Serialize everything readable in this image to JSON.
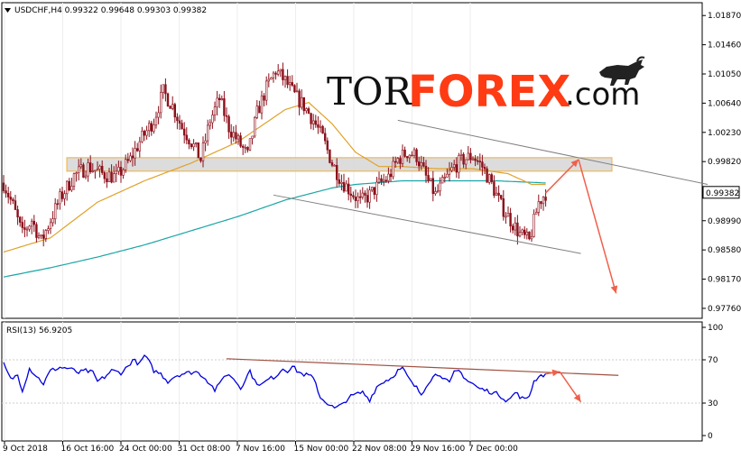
{
  "header": {
    "symbol_line": "USDCHF,H4  0.99322  0.99648  0.99303  0.99382"
  },
  "brand": {
    "tor": "TOR",
    "forex": "FOREX",
    "com": ".com",
    "logo_icon": "bull-icon"
  },
  "rsi_panel": {
    "label": "RSI(13) 56.9205"
  },
  "colors": {
    "candle": "#8b0f1a",
    "ma_slow": "#1aa6a6",
    "ma_fast": "#e0a22a",
    "channel": "#808080",
    "forecast_arrow": "#f0604a",
    "zone_fill": "#d6d6d6",
    "zone_border": "#f0b040",
    "rsi_line": "#0000e0",
    "rsi_trend": "#a05040",
    "brand_accent": "#ff3b14"
  },
  "chart_data": [
    {
      "type": "candlestick",
      "symbol": "USDCHF",
      "timeframe": "H4",
      "ylim": [
        0.9762,
        1.0205
      ],
      "x_ticks": [
        "9 Oct 2018",
        "16 Oct 16:00",
        "24 Oct 00:00",
        "31 Oct 08:00",
        "7 Nov 16:00",
        "15 Nov 00:00",
        "22 Nov 08:00",
        "29 Nov 16:00",
        "7 Dec 00:00"
      ],
      "y_ticks": [
        "1.01870",
        "1.01460",
        "1.01050",
        "1.00640",
        "1.00230",
        "0.99820",
        "0.99382",
        "0.98990",
        "0.98580",
        "0.98170",
        "0.97760"
      ],
      "y_tick_values": [
        1.0187,
        1.0146,
        1.0105,
        1.0064,
        1.0023,
        0.9982,
        0.99382,
        0.9899,
        0.9858,
        0.9817,
        0.9776
      ],
      "current_price": "0.99382",
      "current_price_value": 0.99382,
      "close_anchors": [
        [
          0,
          0.9952
        ],
        [
          4,
          0.992
        ],
        [
          8,
          0.988
        ],
        [
          12,
          0.99
        ],
        [
          16,
          0.987
        ],
        [
          20,
          0.99
        ],
        [
          24,
          0.993
        ],
        [
          30,
          0.9962
        ],
        [
          36,
          0.9975
        ],
        [
          42,
          0.9965
        ],
        [
          48,
          0.996
        ],
        [
          54,
          0.9985
        ],
        [
          58,
          1.001
        ],
        [
          64,
          1.004
        ],
        [
          68,
          1.008
        ],
        [
          72,
          1.006
        ],
        [
          76,
          1.003
        ],
        [
          80,
          1.001
        ],
        [
          84,
          0.9985
        ],
        [
          88,
          1.004
        ],
        [
          92,
          1.007
        ],
        [
          96,
          1.003
        ],
        [
          100,
          1.001
        ],
        [
          104,
          0.999
        ],
        [
          108,
          1.005
        ],
        [
          112,
          1.0085
        ],
        [
          116,
          1.011
        ],
        [
          120,
          1.0095
        ],
        [
          124,
          1.0075
        ],
        [
          128,
          1.006
        ],
        [
          132,
          1.004
        ],
        [
          136,
          1.0015
        ],
        [
          140,
          0.998
        ],
        [
          144,
          0.9955
        ],
        [
          148,
          0.994
        ],
        [
          152,
          0.9925
        ],
        [
          156,
          0.9935
        ],
        [
          160,
          0.995
        ],
        [
          164,
          0.996
        ],
        [
          168,
          0.9985
        ],
        [
          172,
          0.9995
        ],
        [
          176,
          0.999
        ],
        [
          180,
          0.996
        ],
        [
          184,
          0.9935
        ],
        [
          188,
          0.9955
        ],
        [
          192,
          0.9975
        ],
        [
          196,
          0.9985
        ],
        [
          200,
          0.999
        ],
        [
          204,
          0.9975
        ],
        [
          208,
          0.995
        ],
        [
          212,
          0.992
        ],
        [
          216,
          0.99
        ],
        [
          220,
          0.988
        ],
        [
          224,
          0.987
        ],
        [
          228,
          0.9925
        ],
        [
          231,
          0.9938
        ]
      ],
      "ma_fast_anchors": [
        [
          0,
          0.9855
        ],
        [
          20,
          0.9875
        ],
        [
          40,
          0.9925
        ],
        [
          60,
          0.9955
        ],
        [
          80,
          0.998
        ],
        [
          100,
          1.001
        ],
        [
          120,
          1.0055
        ],
        [
          130,
          1.0065
        ],
        [
          140,
          1.0035
        ],
        [
          150,
          0.9995
        ],
        [
          160,
          0.9975
        ],
        [
          170,
          0.9975
        ],
        [
          185,
          0.9972
        ],
        [
          200,
          0.9972
        ],
        [
          215,
          0.9965
        ],
        [
          225,
          0.995
        ],
        [
          231,
          0.995
        ]
      ],
      "ma_slow_anchors": [
        [
          0,
          0.982
        ],
        [
          20,
          0.9833
        ],
        [
          40,
          0.9848
        ],
        [
          60,
          0.9865
        ],
        [
          80,
          0.9885
        ],
        [
          100,
          0.9905
        ],
        [
          120,
          0.9928
        ],
        [
          140,
          0.9945
        ],
        [
          150,
          0.995
        ],
        [
          170,
          0.9955
        ],
        [
          190,
          0.9955
        ],
        [
          210,
          0.9955
        ],
        [
          231,
          0.9952
        ]
      ],
      "resistance_zone": [
        0.99685,
        0.99875
      ],
      "channel_upper": [
        [
          168,
          1.004
        ],
        [
          300,
          0.995
        ]
      ],
      "channel_lower": [
        [
          115,
          0.9935
        ],
        [
          246,
          0.9853
        ]
      ],
      "forecast": [
        [
          231,
          0.9938
        ],
        [
          245,
          0.9985
        ],
        [
          261,
          0.9797
        ]
      ]
    },
    {
      "type": "line",
      "title": "RSI(13) 56.9205",
      "ylim": [
        -5,
        105
      ],
      "y_ticks": [
        "100",
        "70",
        "30",
        "0"
      ],
      "y_tick_values": [
        100,
        70,
        30,
        0
      ],
      "rsi_anchors": [
        [
          0,
          66
        ],
        [
          3,
          52
        ],
        [
          6,
          56
        ],
        [
          8,
          42
        ],
        [
          11,
          62
        ],
        [
          14,
          55
        ],
        [
          17,
          48
        ],
        [
          20,
          60
        ],
        [
          24,
          63
        ],
        [
          28,
          62
        ],
        [
          32,
          58
        ],
        [
          35,
          60
        ],
        [
          38,
          58
        ],
        [
          40,
          50
        ],
        [
          43,
          54
        ],
        [
          46,
          60
        ],
        [
          50,
          58
        ],
        [
          53,
          64
        ],
        [
          55,
          70
        ],
        [
          58,
          66
        ],
        [
          60,
          74
        ],
        [
          62,
          68
        ],
        [
          64,
          60
        ],
        [
          67,
          57
        ],
        [
          70,
          50
        ],
        [
          73,
          55
        ],
        [
          76,
          57
        ],
        [
          79,
          58
        ],
        [
          82,
          59
        ],
        [
          85,
          55
        ],
        [
          88,
          48
        ],
        [
          90,
          42
        ],
        [
          92,
          47
        ],
        [
          94,
          56
        ],
        [
          97,
          55
        ],
        [
          99,
          50
        ],
        [
          101,
          44
        ],
        [
          103,
          52
        ],
        [
          105,
          60
        ],
        [
          107,
          50
        ],
        [
          110,
          47
        ],
        [
          113,
          52
        ],
        [
          116,
          55
        ],
        [
          119,
          62
        ],
        [
          121,
          60
        ],
        [
          123,
          64
        ],
        [
          125,
          60
        ],
        [
          127,
          57
        ],
        [
          129,
          56
        ],
        [
          131,
          55
        ],
        [
          133,
          48
        ],
        [
          135,
          35
        ],
        [
          138,
          30
        ],
        [
          141,
          25
        ],
        [
          144,
          28
        ],
        [
          147,
          35
        ],
        [
          150,
          38
        ],
        [
          153,
          40
        ],
        [
          156,
          33
        ],
        [
          159,
          45
        ],
        [
          162,
          50
        ],
        [
          165,
          53
        ],
        [
          168,
          60
        ],
        [
          170,
          62
        ],
        [
          172,
          55
        ],
        [
          174,
          48
        ],
        [
          176,
          44
        ],
        [
          178,
          38
        ],
        [
          180,
          46
        ],
        [
          182,
          52
        ],
        [
          184,
          56
        ],
        [
          186,
          57
        ],
        [
          188,
          52
        ],
        [
          190,
          48
        ],
        [
          192,
          58
        ],
        [
          194,
          60
        ],
        [
          196,
          55
        ],
        [
          198,
          50
        ],
        [
          200,
          48
        ],
        [
          202,
          44
        ],
        [
          205,
          42
        ],
        [
          208,
          40
        ],
        [
          211,
          38
        ],
        [
          214,
          33
        ],
        [
          216,
          34
        ],
        [
          218,
          40
        ],
        [
          220,
          36
        ],
        [
          222,
          33
        ],
        [
          224,
          37
        ],
        [
          226,
          50
        ],
        [
          228,
          55
        ],
        [
          230,
          56
        ],
        [
          231,
          56.9
        ]
      ],
      "rsi_trendline": [
        [
          95,
          71
        ],
        [
          262,
          55.6
        ]
      ],
      "forecast": [
        [
          231,
          57
        ],
        [
          237,
          59
        ],
        [
          246,
          31
        ]
      ]
    }
  ]
}
